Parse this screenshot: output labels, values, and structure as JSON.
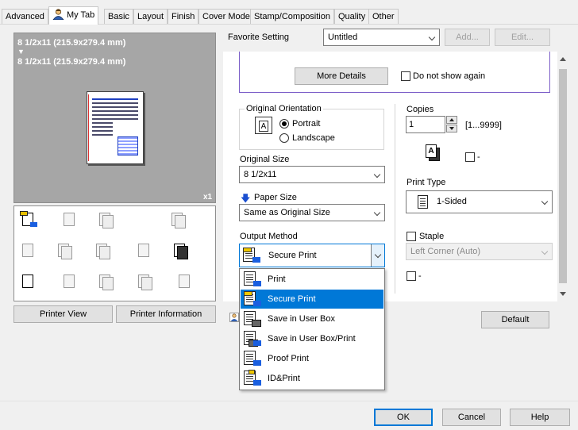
{
  "tabs": [
    {
      "label": "Advanced"
    },
    {
      "label": "My Tab"
    },
    {
      "label": "Basic"
    },
    {
      "label": "Layout"
    },
    {
      "label": "Finish"
    },
    {
      "label": "Cover Mode"
    },
    {
      "label": "Stamp/Composition"
    },
    {
      "label": "Quality"
    },
    {
      "label": "Other"
    }
  ],
  "preview": {
    "line1": "8 1/2x11 (215.9x279.4 mm)",
    "arrow": "▼",
    "line2": "8 1/2x11 (215.9x279.4 mm)",
    "copies_indicator": "x1"
  },
  "left_buttons": {
    "printer_view": "Printer View",
    "printer_information": "Printer Information"
  },
  "favorite": {
    "label": "Favorite Setting",
    "value": "Untitled",
    "add": "Add...",
    "edit": "Edit..."
  },
  "details": {
    "more_details": "More Details",
    "do_not_show": "Do not show again"
  },
  "orientation": {
    "legend": "Original Orientation",
    "portrait": "Portrait",
    "landscape": "Landscape",
    "icon_letter": "A"
  },
  "original_size": {
    "label": "Original Size",
    "value": "8 1/2x11"
  },
  "paper_size": {
    "label": "Paper Size",
    "arrow": "🡇",
    "value": "Same as Original Size"
  },
  "output_method": {
    "label": "Output Method",
    "value": "Secure Print",
    "options": [
      {
        "label": "Print"
      },
      {
        "label": "Secure Print"
      },
      {
        "label": "Save in User Box"
      },
      {
        "label": "Save in User Box/Print"
      },
      {
        "label": "Proof Print"
      },
      {
        "label": "ID&Print"
      }
    ],
    "selected_index": 1
  },
  "copies": {
    "label": "Copies",
    "value": "1",
    "range": "[1...9999]",
    "collate_text": "-"
  },
  "print_type": {
    "label": "Print Type",
    "value": "1-Sided"
  },
  "staple": {
    "label": "Staple",
    "value": "Left Corner (Auto)"
  },
  "punch": {
    "text": "-"
  },
  "default_button": "Default",
  "dialog_buttons": {
    "ok": "OK",
    "cancel": "Cancel",
    "help": "Help"
  }
}
